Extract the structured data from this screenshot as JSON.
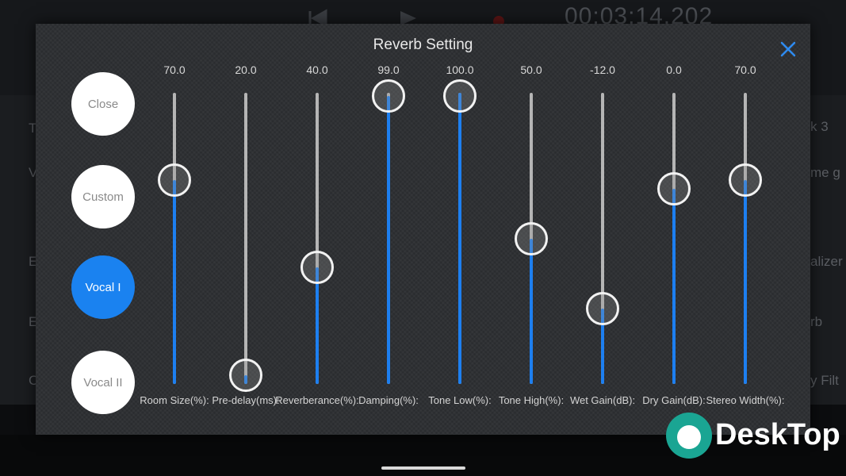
{
  "background": {
    "timecode": "00:03:14.202",
    "right_items": [
      "k 3",
      "me g",
      "alizer",
      "rb",
      "y Filt"
    ],
    "left_items": [
      "T",
      "V",
      "E",
      "E",
      "C"
    ]
  },
  "dialog": {
    "title": "Reverb Setting",
    "close_icon": "close-x-icon"
  },
  "presets": [
    {
      "label": "Close",
      "active": false
    },
    {
      "label": "Custom",
      "active": false
    },
    {
      "label": "Vocal I",
      "active": true
    },
    {
      "label": "Vocal II",
      "active": false
    }
  ],
  "sliders": [
    {
      "value": "70.0",
      "label": "Room Size(%):",
      "level": 0.7
    },
    {
      "value": "20.0",
      "label": "Pre-delay(ms):",
      "level": 0.03
    },
    {
      "value": "40.0",
      "label": "Reverberance(%):",
      "level": 0.4
    },
    {
      "value": "99.0",
      "label": "Damping(%):",
      "level": 0.99
    },
    {
      "value": "100.0",
      "label": "Tone Low(%):",
      "level": 1.0
    },
    {
      "value": "50.0",
      "label": "Tone High(%):",
      "level": 0.5
    },
    {
      "value": "-12.0",
      "label": "Wet Gain(dB):",
      "level": 0.26
    },
    {
      "value": "0.0",
      "label": "Dry Gain(dB):",
      "level": 0.67
    },
    {
      "value": "70.0",
      "label": "Stereo Width(%):",
      "level": 0.7
    }
  ],
  "colors": {
    "accent": "#1d7ff0",
    "track": "#b5b5b5",
    "dialog_bg": "#2a2c2f"
  },
  "watermark": {
    "text": "DeskTop"
  }
}
